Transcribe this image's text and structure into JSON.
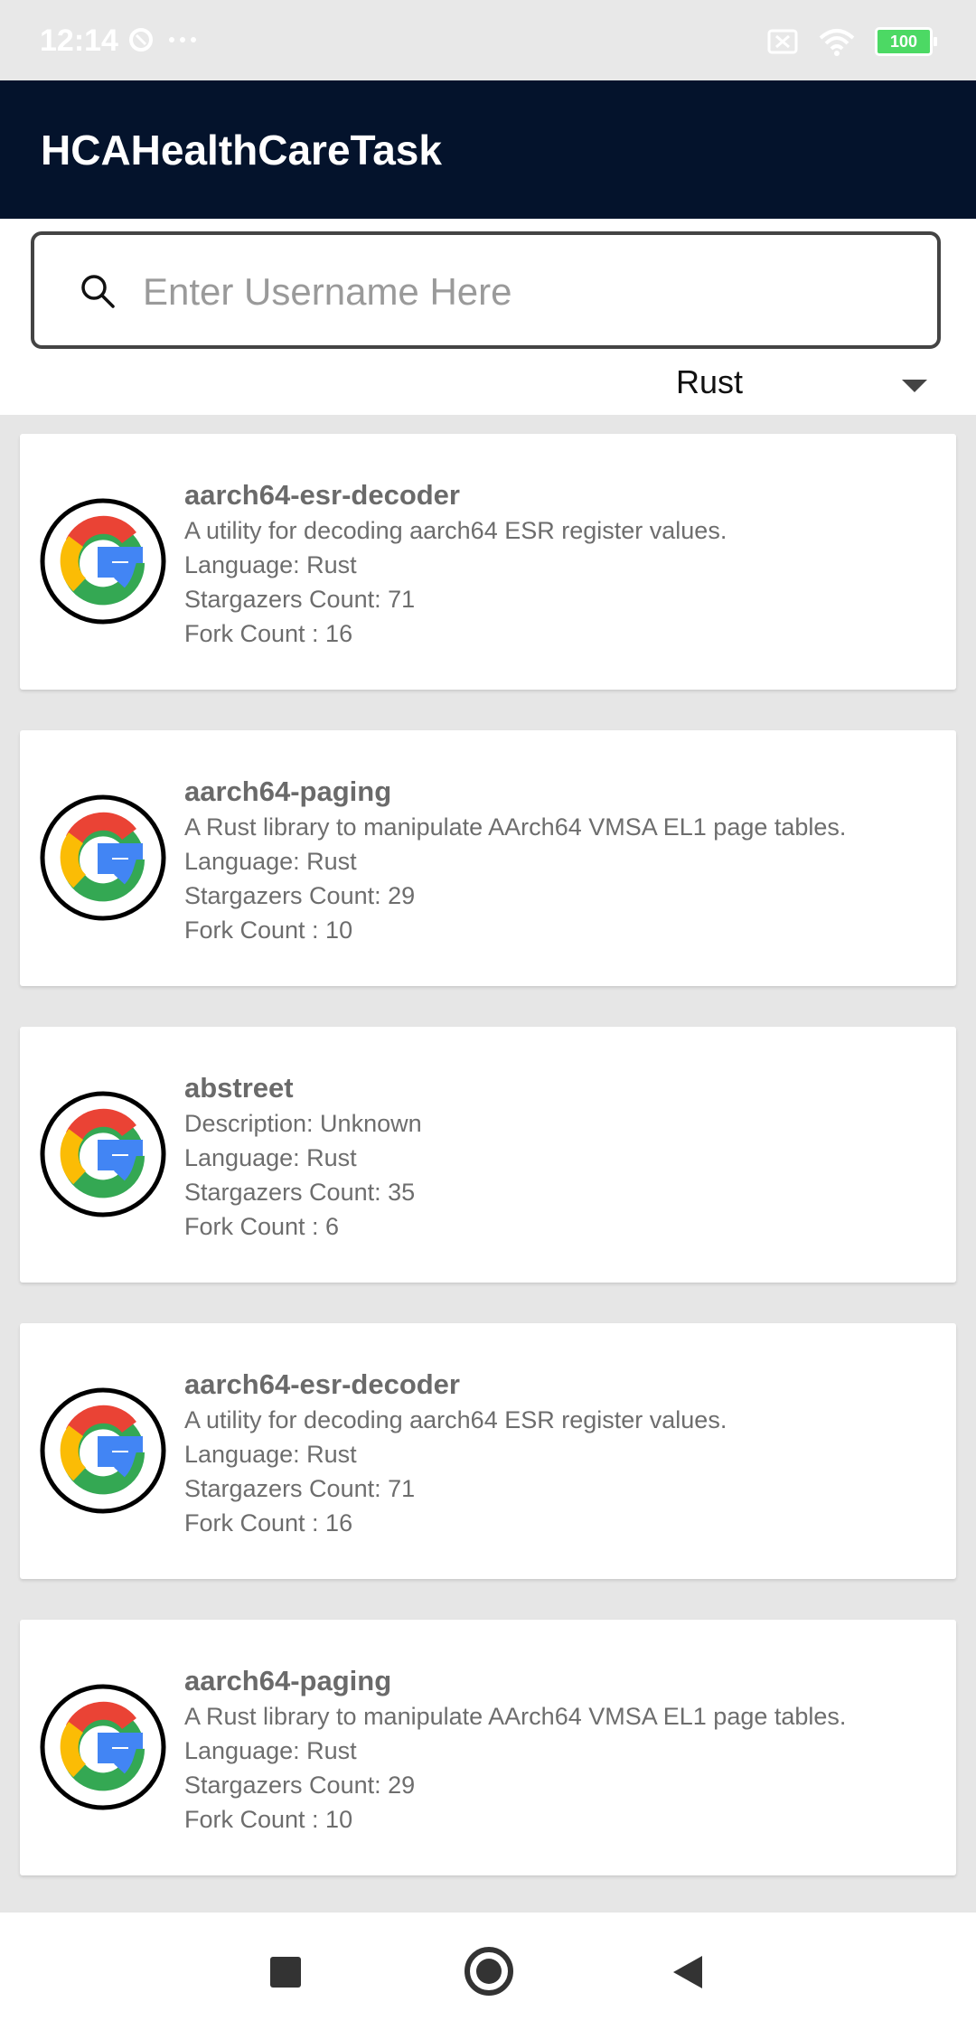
{
  "status_bar": {
    "time": "12:14",
    "battery": "100"
  },
  "app_bar": {
    "title": "HCAHealthCareTask"
  },
  "search": {
    "placeholder": "Enter Username Here",
    "value": ""
  },
  "language_dropdown": {
    "selected": "Rust"
  },
  "repos": [
    {
      "name": "aarch64-esr-decoder",
      "description": "A utility for decoding aarch64 ESR register values.",
      "language": "Language: Rust",
      "stargazers": "Stargazers Count: 71",
      "forks": "Fork Count : 16"
    },
    {
      "name": "aarch64-paging",
      "description": "A Rust library to manipulate AArch64 VMSA EL1 page tables.",
      "language": "Language: Rust",
      "stargazers": "Stargazers Count: 29",
      "forks": "Fork Count : 10"
    },
    {
      "name": "abstreet",
      "description": "Description: Unknown",
      "language": "Language: Rust",
      "stargazers": "Stargazers Count: 35",
      "forks": "Fork Count : 6"
    },
    {
      "name": "aarch64-esr-decoder",
      "description": "A utility for decoding aarch64 ESR register values.",
      "language": "Language: Rust",
      "stargazers": "Stargazers Count: 71",
      "forks": "Fork Count : 16"
    },
    {
      "name": "aarch64-paging",
      "description": "A Rust library to manipulate AArch64 VMSA EL1 page tables.",
      "language": "Language: Rust",
      "stargazers": "Stargazers Count: 29",
      "forks": "Fork Count : 10"
    }
  ],
  "icons": {
    "avatar": "google-g-logo-icon",
    "search": "search-icon",
    "dropdown": "caret-down-icon",
    "nav": [
      "recents-square-icon",
      "home-circle-icon",
      "back-triangle-icon"
    ]
  },
  "colors": {
    "app_bar": "#04132c",
    "background": "#e6e6e6",
    "card": "#ffffff"
  }
}
